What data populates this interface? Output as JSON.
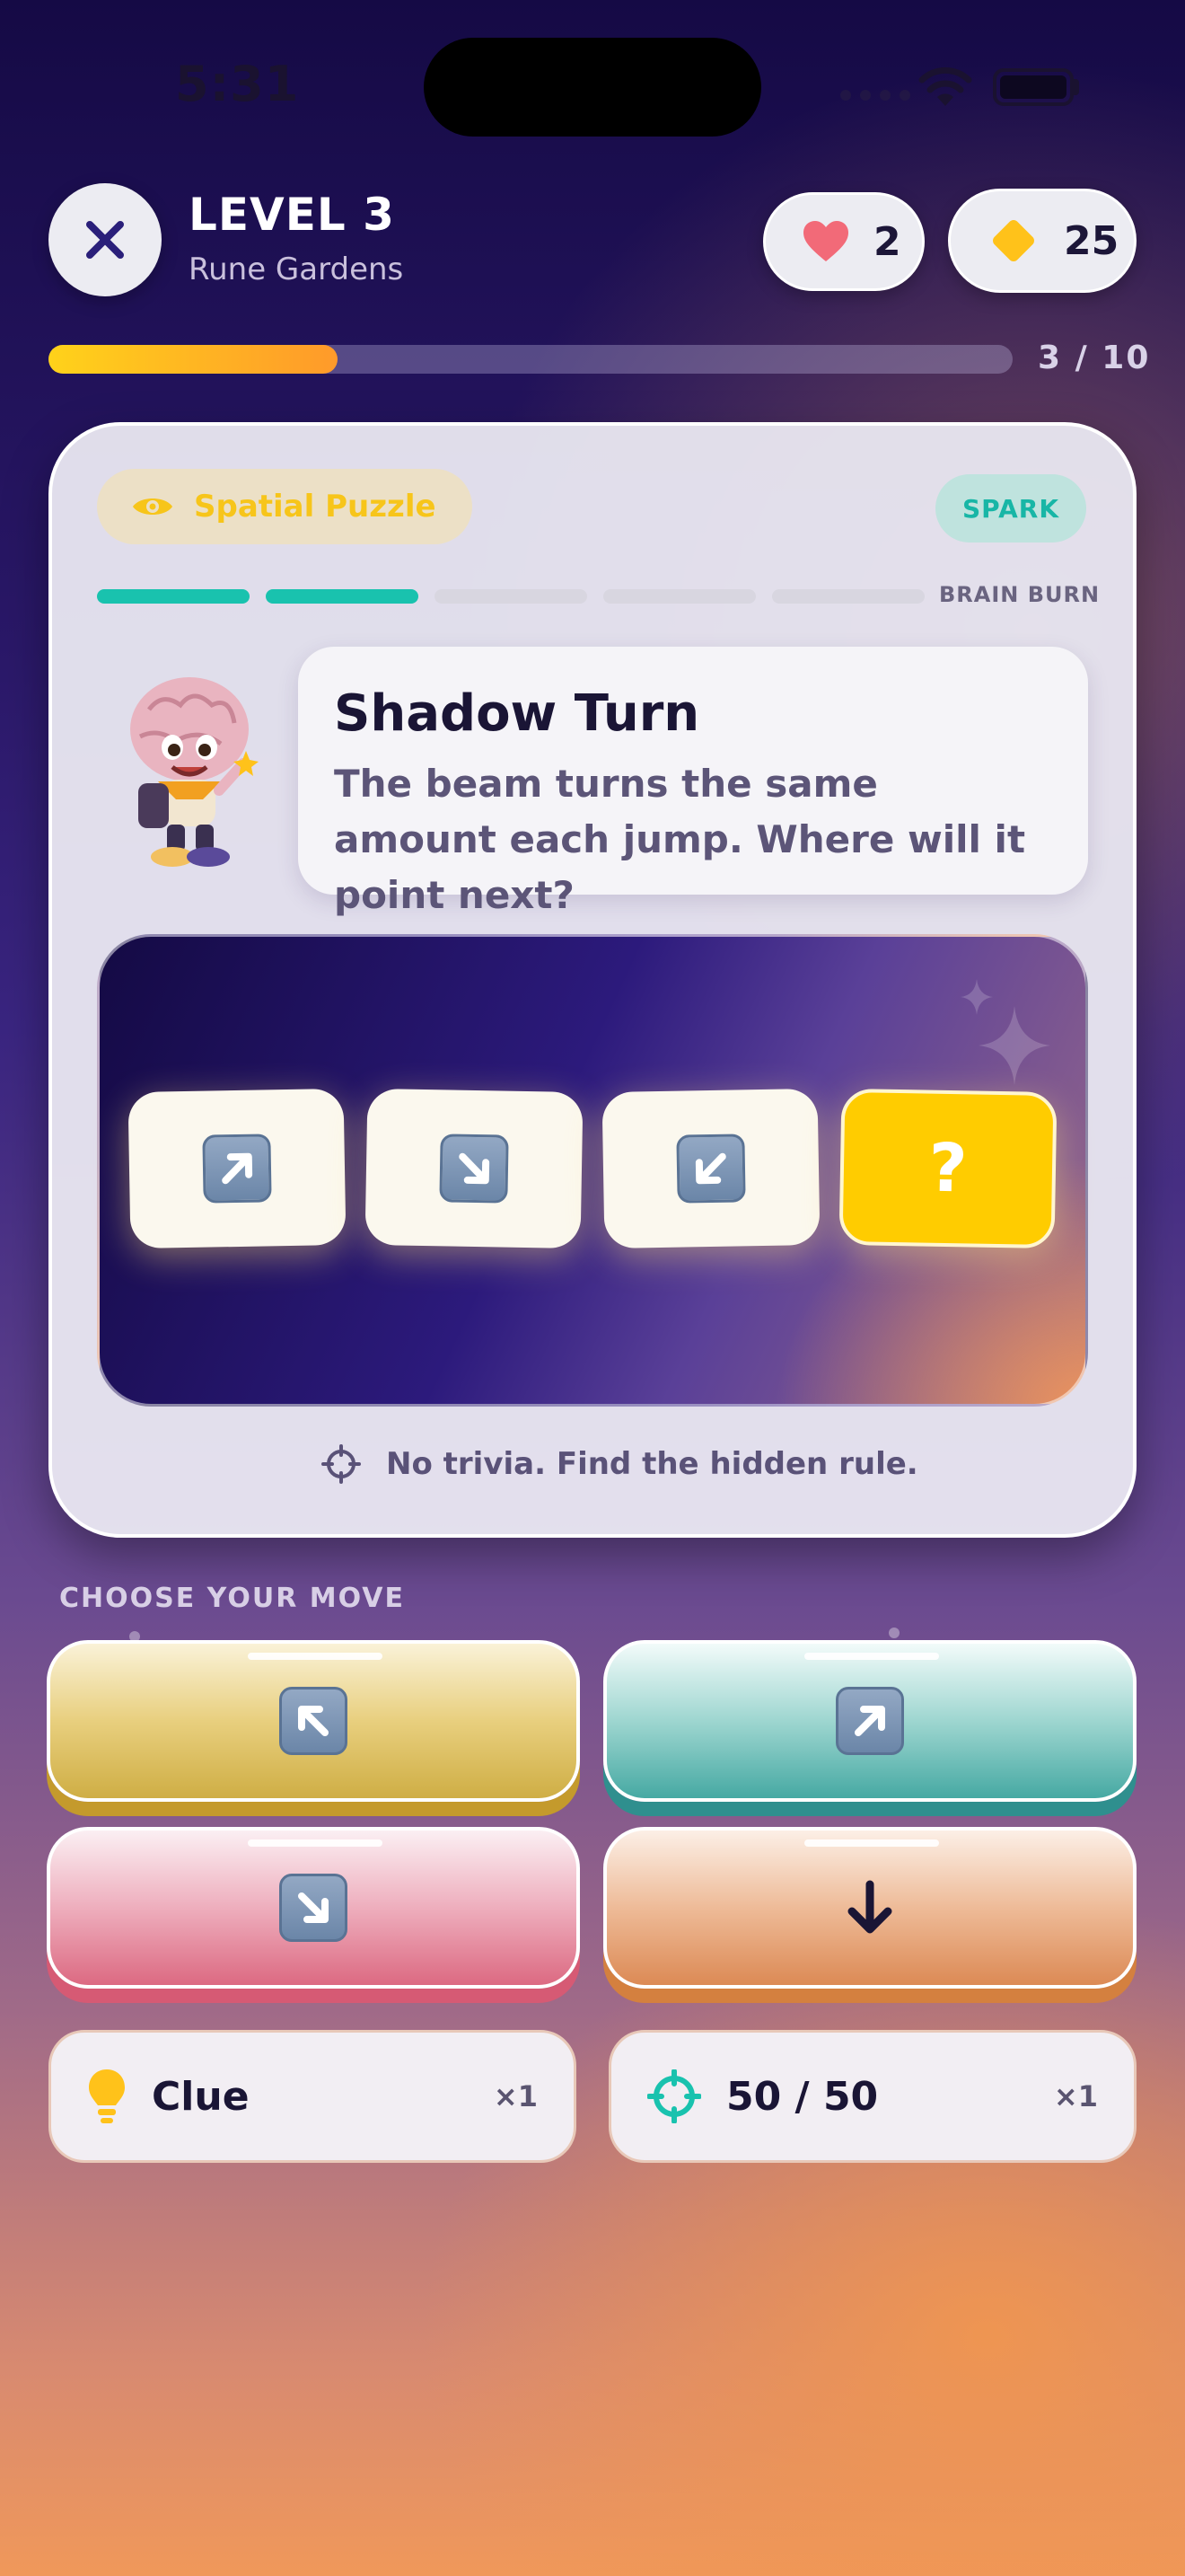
{
  "status_bar": {
    "time": "5:31"
  },
  "header": {
    "level": "LEVEL 3",
    "world": "Rune Gardens",
    "lives": "2",
    "gems": "25"
  },
  "progress": {
    "label": "3 / 10",
    "current": 3,
    "total": 10
  },
  "card": {
    "category": "Spatial Puzzle",
    "difficulty_tag": "SPARK",
    "difficulty_scale_label": "BRAIN BURN",
    "difficulty_level": 2,
    "difficulty_steps": 5,
    "title": "Shadow Turn",
    "description": "The beam turns the same amount each jump. Where will it point next?",
    "sequence": [
      {
        "icon": "arrow-up-right-icon",
        "glyph": "↗"
      },
      {
        "icon": "arrow-down-right-icon",
        "glyph": "↘"
      },
      {
        "icon": "arrow-down-left-icon",
        "glyph": "↙"
      },
      {
        "icon": "question-icon",
        "glyph": "?"
      }
    ],
    "hint": "No trivia. Find the hidden rule."
  },
  "choices": {
    "heading": "CHOOSE YOUR MOVE",
    "options": [
      {
        "icon": "arrow-up-left-icon",
        "glyph": "↖",
        "color": "#cfae45"
      },
      {
        "icon": "arrow-up-right-icon",
        "glyph": "↗",
        "color": "#46a9a3"
      },
      {
        "icon": "arrow-down-right-icon",
        "glyph": "↘",
        "color": "#dc6a82"
      },
      {
        "icon": "arrow-down-icon",
        "glyph": "↓",
        "color": "#dc8a55"
      }
    ]
  },
  "powerups": [
    {
      "label": "Clue",
      "count": "×1",
      "icon": "lightbulb-icon"
    },
    {
      "label": "50 / 50",
      "count": "×1",
      "icon": "crosshair-icon"
    }
  ],
  "colors": {
    "accent_yellow": "#ffcc00",
    "accent_teal": "#19c2ae",
    "text_dark": "#1a1535"
  }
}
